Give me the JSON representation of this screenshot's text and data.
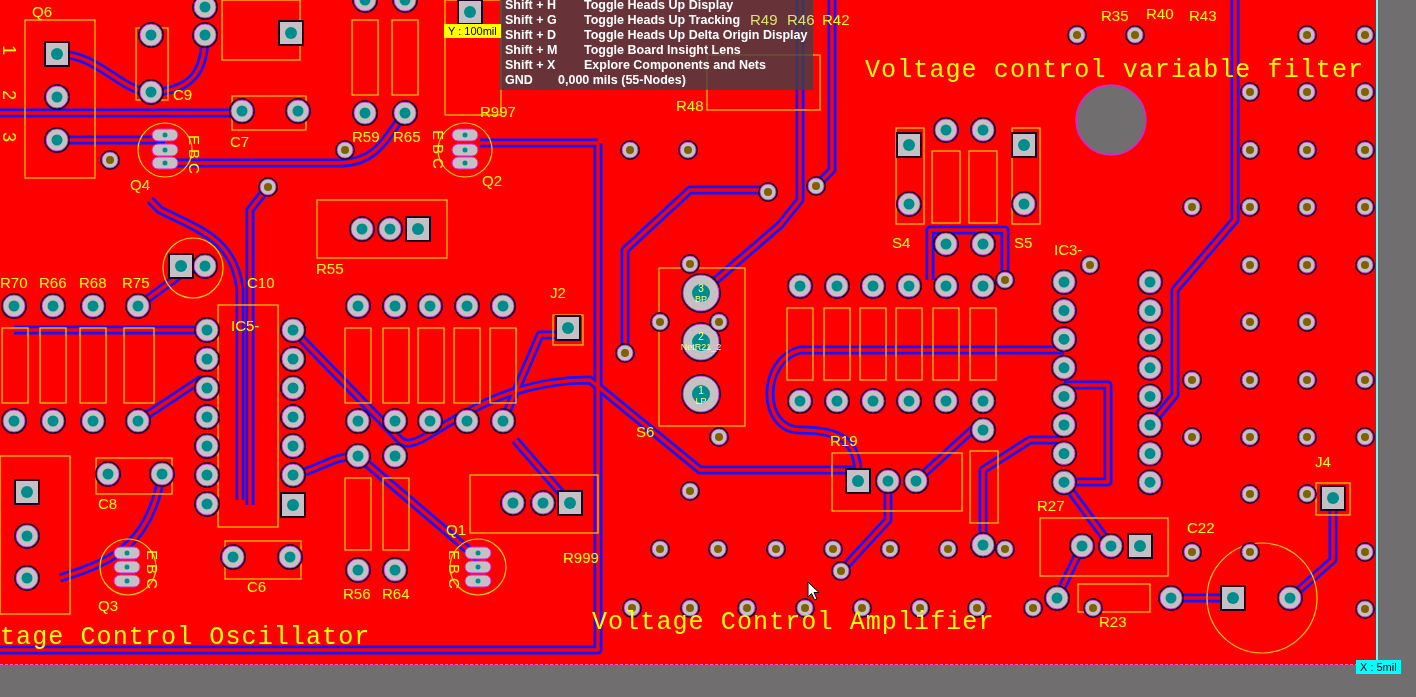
{
  "hud": {
    "shortcuts": [
      {
        "keys": "Shift + H",
        "action": "Toggle Heads Up Display"
      },
      {
        "keys": "Shift + G",
        "action": "Toggle Heads Up Tracking"
      },
      {
        "keys": "Shift + D",
        "action": "Toggle Heads Up Delta Origin Display"
      },
      {
        "keys": "Shift + M",
        "action": "Toggle Board Insight Lens"
      },
      {
        "keys": "Shift + X",
        "action": "Explore Components and Nets"
      }
    ],
    "net": {
      "name": "GND",
      "info": "0,000 mils (55-Nodes)"
    }
  },
  "cursor_readouts": [
    {
      "kind": "y",
      "text": "Y : 100mil"
    },
    {
      "kind": "x",
      "text": "X : 5mil"
    }
  ],
  "section_titles": [
    "Voltage control variable filter",
    "Voltage Control Amplifier",
    "tage Control Oscillator"
  ],
  "designators": [
    "Q6",
    "C9",
    "C7",
    "R59",
    "R65",
    "R997",
    "Q2",
    "Q4",
    "R55",
    "R70",
    "R66",
    "R68",
    "R75",
    "C10",
    "IC5-",
    "J2",
    "C8",
    "Q3",
    "C6",
    "R56",
    "R64",
    "Q1",
    "R999",
    "S6",
    "R48",
    "R49",
    "R46",
    "R42",
    "R35",
    "R40",
    "R43",
    "S4",
    "S5",
    "IC3-",
    "R19",
    "R27",
    "C22",
    "J4",
    "R23"
  ],
  "transistor_pin_labels": [
    "EBC",
    "EBC",
    "EBC",
    "EBC"
  ],
  "connector_pins": [
    "1",
    "2",
    "3"
  ],
  "pad_labels": [
    "3",
    "BP",
    "2",
    "NetR21_2",
    "1",
    "LP"
  ]
}
